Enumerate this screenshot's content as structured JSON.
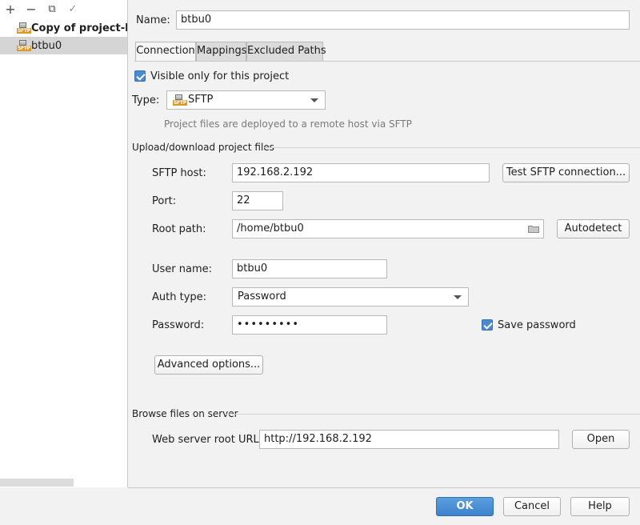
{
  "toolbar": {
    "add": "+",
    "remove": "−",
    "copy": "⧉",
    "check": "✓"
  },
  "tree": {
    "items": [
      {
        "label": "Copy of project-lev",
        "bold": true
      },
      {
        "label": "btbu0",
        "bold": false
      }
    ]
  },
  "form": {
    "name_label": "Name:",
    "name_value": "btbu0",
    "tabs": [
      "Connection",
      "Mappings",
      "Excluded Paths"
    ],
    "visible_only_label": "Visible only for this project",
    "type_label": "Type:",
    "type_value": "SFTP",
    "type_description": "Project files are deployed to a remote host via SFTP",
    "upload_section": "Upload/download project files",
    "host_label": "SFTP host:",
    "host_value": "192.168.2.192",
    "test_button": "Test SFTP connection...",
    "port_label": "Port:",
    "port_value": "22",
    "root_label": "Root path:",
    "root_value": "/home/btbu0",
    "autodetect_button": "Autodetect",
    "user_label": "User name:",
    "user_value": "btbu0",
    "auth_label": "Auth type:",
    "auth_value": "Password",
    "password_label": "Password:",
    "password_value": "•••••••••",
    "save_password_label": "Save password",
    "advanced_button": "Advanced options...",
    "browse_section": "Browse files on server",
    "web_root_label": "Web server root URL:",
    "web_root_value": "http://192.168.2.192",
    "open_button": "Open"
  },
  "footer": {
    "ok": "OK",
    "cancel": "Cancel",
    "help": "Help"
  },
  "colors": {
    "primary_button": "#3d83cc",
    "checkbox": "#4a8ad0",
    "selected_row": "#d5d5d5"
  }
}
